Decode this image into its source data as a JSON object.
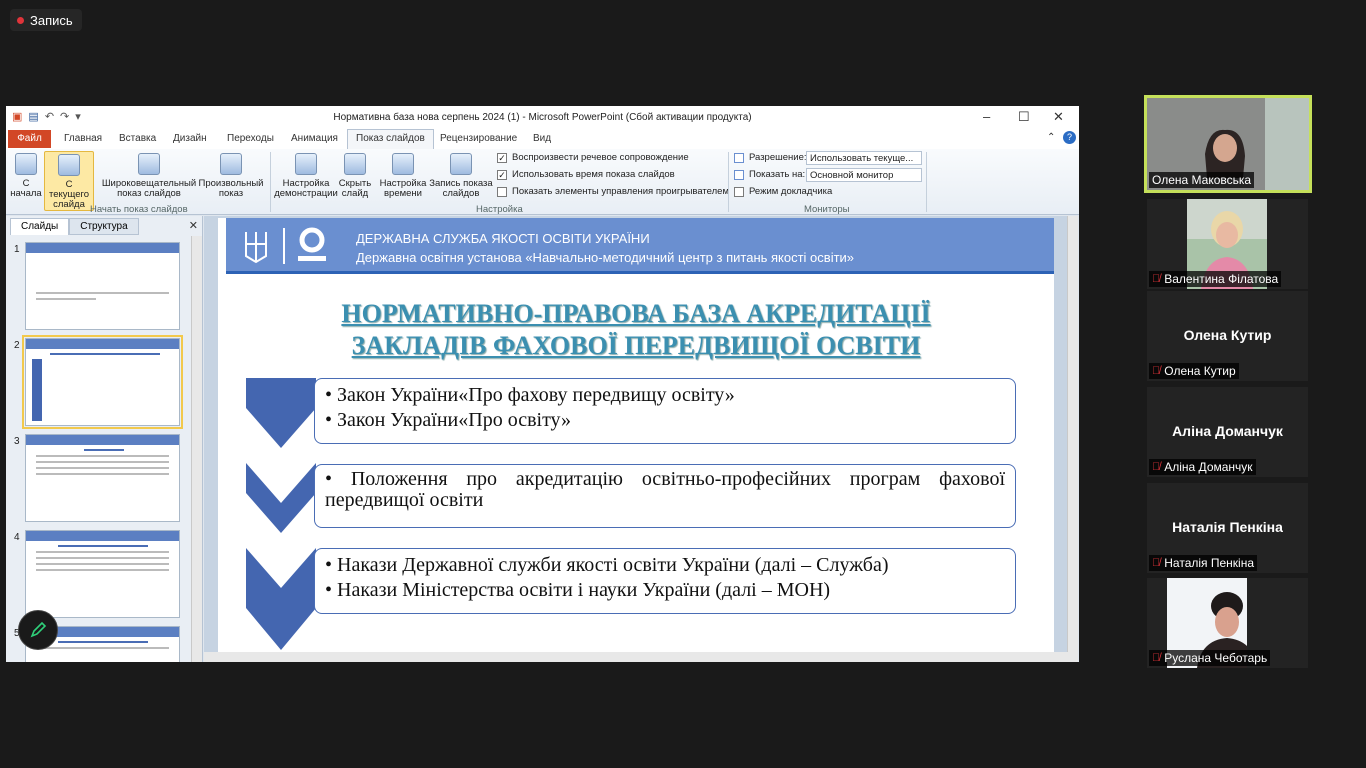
{
  "recording": {
    "label": "Запись"
  },
  "window": {
    "title": "Нормативна база нова серпень 2024 (1)  -  Microsoft PowerPoint (Сбой активации продукта)"
  },
  "tabs": [
    "Файл",
    "Главная",
    "Вставка",
    "Дизайн",
    "Переходы",
    "Анимация",
    "Показ слайдов",
    "Рецензирование",
    "Вид"
  ],
  "ribbon": {
    "start_from_beginning": "С начала",
    "start_from_current_1": "С текущего",
    "start_from_current_2": "слайда",
    "broadcast_1": "Широковещательный",
    "broadcast_2": "показ слайдов",
    "custom_1": "Произвольный",
    "custom_2": "показ",
    "group_start": "Начать показ слайдов",
    "setup_1": "Настройка",
    "setup_2": "демонстрации",
    "hide_1": "Скрыть",
    "hide_2": "слайд",
    "timing_1": "Настройка",
    "timing_2": "времени",
    "record_1": "Запись показа",
    "record_2": "слайдов",
    "chk_narration": "Воспроизвести речевое сопровождение",
    "chk_timings": "Использовать время показа слайдов",
    "chk_media": "Показать элементы управления проигрывателем",
    "group_setup": "Настройка",
    "resolution_label": "Разрешение:",
    "resolution_value": "Использовать текуще...",
    "showon_label": "Показать на:",
    "showon_value": "Основной монитор",
    "presenter_view": "Режим докладчика",
    "group_monitors": "Мониторы"
  },
  "panel": {
    "tab_slides": "Слайды",
    "tab_outline": "Структура",
    "close": "✕",
    "numbers": [
      "1",
      "2",
      "3",
      "4",
      "5"
    ]
  },
  "slide": {
    "header_1": "ДЕРЖАВНА СЛУЖБА ЯКОСТІ ОСВІТИ УКРАЇНИ",
    "header_2": "Державна освітня установа «Навчально-методичний центр з питань якості освіти»",
    "title_1": "НОРМАТИВНО-ПРАВОВА БАЗА АКРЕДИТАЦІЇ",
    "title_2": "ЗАКЛАДІВ ФАХОВОЇ ПЕРЕДВИЩОЇ ОСВІТИ",
    "box1": [
      "• Закон України«Про  фахову передвищу освіту»",
      "• Закон України«Про  освіту»"
    ],
    "box2": [
      "• Положення  про  акредитацію  освітньо-професійних  програм фахової передвищої освіти"
    ],
    "box3": [
      "• Накази Державної служби якості освіти України (далі – Служба)",
      "• Накази Міністерства освіти і науки України (далі – МОН)"
    ]
  },
  "participants": [
    {
      "name": "Олена Маковська",
      "muted": false,
      "video": true
    },
    {
      "name": "Валентина Філатова",
      "muted": true,
      "video": true
    },
    {
      "name": "Олена Кутир",
      "muted": true,
      "video": false
    },
    {
      "name": "Аліна Доманчук",
      "muted": true,
      "video": false
    },
    {
      "name": "Наталія Пенкіна",
      "muted": true,
      "video": false
    },
    {
      "name": "Руслана Чеботарь",
      "muted": true,
      "video": true
    }
  ],
  "colors": {
    "ppt_file_tab": "#d24726",
    "slide_banner": "#6a8fd0",
    "chevron": "#4466b0",
    "speaker_border": "#c5e05a",
    "rec_dot": "#e0343a"
  },
  "icons": [
    "record-dot-icon",
    "pen-icon",
    "mic-muted-icon",
    "minimize-icon",
    "maximize-icon",
    "close-icon",
    "help-icon"
  ]
}
